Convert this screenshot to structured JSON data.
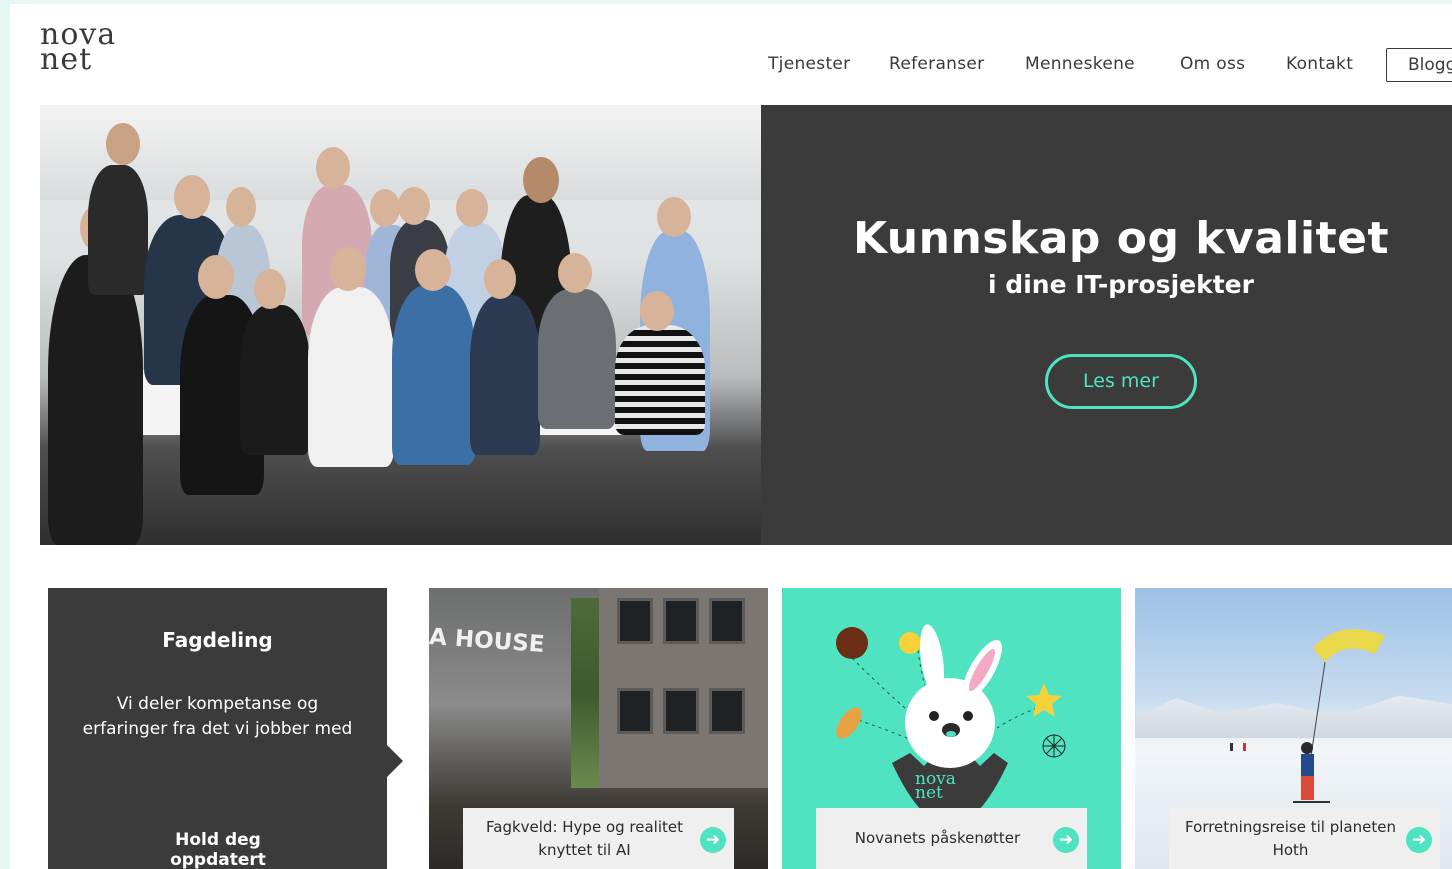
{
  "header": {
    "logo_line1": "nova",
    "logo_line2": "net",
    "nav": [
      "Tjenester",
      "Referanser",
      "Menneskene",
      "Om oss",
      "Kontakt"
    ],
    "blog": "Blogg"
  },
  "hero": {
    "title": "Kunnskap og kvalitet",
    "subtitle": "i dine IT-prosjekter",
    "button": "Les mer"
  },
  "fagdeling": {
    "title": "Fagdeling",
    "text": "Vi deler kompetanse og erfaringer fra det vi jobber med",
    "link": "Hold deg oppdatert"
  },
  "cards": [
    {
      "label": "Fagkveld: Hype og realitet knyttet til AI",
      "sign": "A HOUSE"
    },
    {
      "label": "Novanets påskenøtter",
      "logo_line1": "nova",
      "logo_line2": "net"
    },
    {
      "label": "Forretningsreise til planeten Hoth"
    }
  ],
  "colors": {
    "accent": "#4fe3c2",
    "dark": "#3b3b3b"
  },
  "icons": {
    "card_arrow": "arrow-right-icon"
  }
}
